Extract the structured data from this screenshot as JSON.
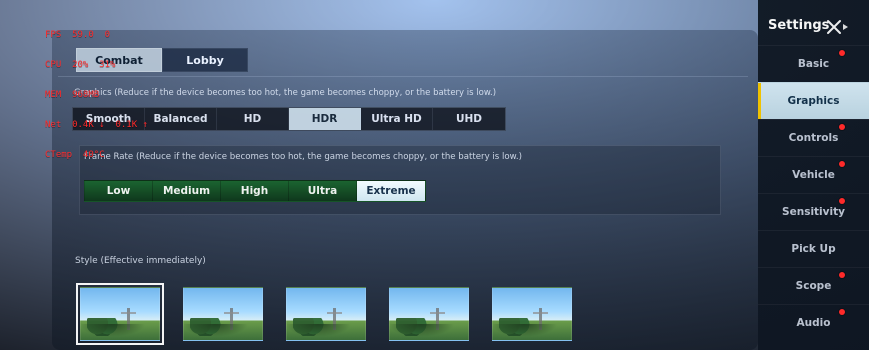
{
  "debug": {
    "lines": [
      "FPS  59.0  0",
      "CPU  20%  31%",
      "MEM  968MB",
      "Net  0.4K ↓  0.1K ↑",
      "CTemp  40°C"
    ]
  },
  "top_tabs": [
    {
      "label": "Combat",
      "active": true
    },
    {
      "label": "Lobby",
      "active": false
    }
  ],
  "graphics": {
    "label": "Graphics (Reduce if the device becomes too hot, the game becomes choppy, or the battery is low.)",
    "options": [
      {
        "label": "Smooth",
        "selected": false
      },
      {
        "label": "Balanced",
        "selected": false
      },
      {
        "label": "HD",
        "selected": false
      },
      {
        "label": "HDR",
        "selected": true
      },
      {
        "label": "Ultra HD",
        "selected": false
      },
      {
        "label": "UHD",
        "selected": false
      }
    ]
  },
  "frame_rate": {
    "label": "Frame Rate (Reduce if the device becomes too hot, the game becomes choppy, or the battery is low.)",
    "options": [
      {
        "label": "Low",
        "selected": false
      },
      {
        "label": "Medium",
        "selected": false
      },
      {
        "label": "High",
        "selected": false
      },
      {
        "label": "Ultra",
        "selected": false
      },
      {
        "label": "Extreme",
        "selected": true
      }
    ]
  },
  "style": {
    "label": "Style (Effective immediately)",
    "selected_index": 0
  },
  "settings": {
    "title": "Settings",
    "menu": [
      {
        "label": "Basic",
        "active": false,
        "dot": true
      },
      {
        "label": "Graphics",
        "active": true,
        "dot": false
      },
      {
        "label": "Controls",
        "active": false,
        "dot": true
      },
      {
        "label": "Vehicle",
        "active": false,
        "dot": true
      },
      {
        "label": "Sensitivity",
        "active": false,
        "dot": true
      },
      {
        "label": "Pick Up",
        "active": false,
        "dot": false
      },
      {
        "label": "Scope",
        "active": false,
        "dot": true
      },
      {
        "label": "Audio",
        "active": false,
        "dot": true
      }
    ]
  },
  "icons": {
    "close": "close-icon",
    "back": "back-arrow-icon"
  },
  "colors": {
    "accent_yellow": "#f0c200",
    "frame_rate_green": "#1f6a33",
    "notification_red": "#ff2a2a"
  }
}
